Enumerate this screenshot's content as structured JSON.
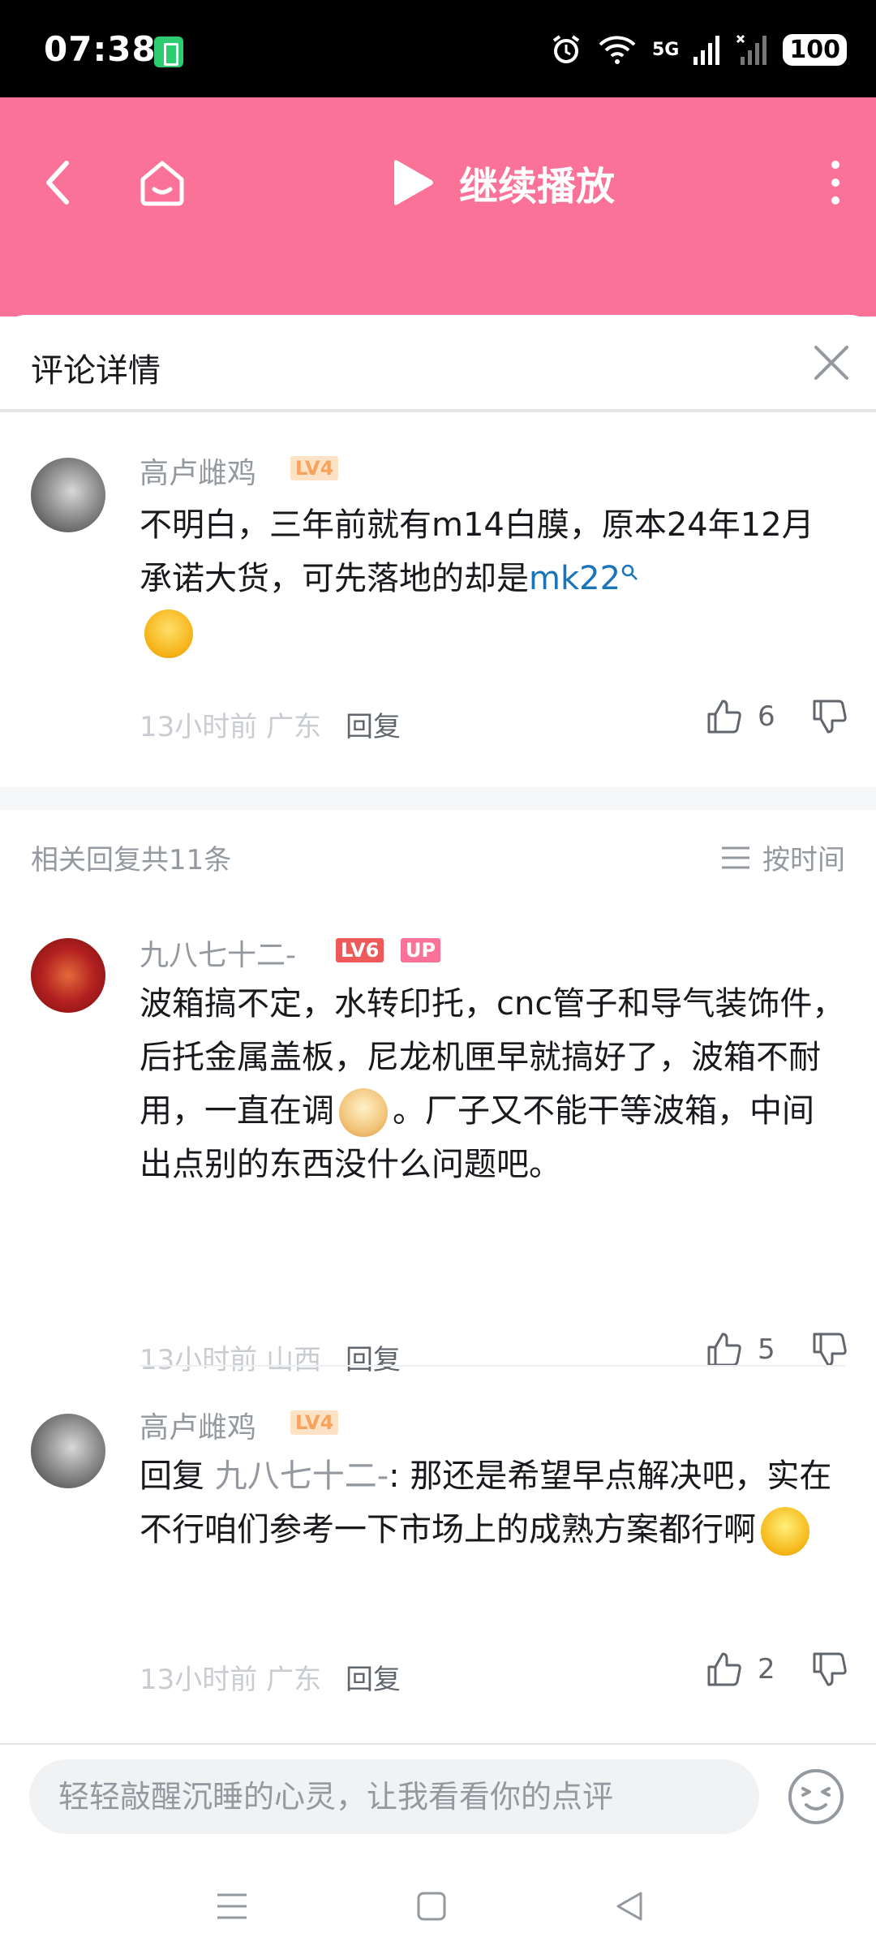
{
  "status_bar": {
    "time": "07:38",
    "network": "5G",
    "battery": "100"
  },
  "top_bar": {
    "play_label": "继续播放",
    "accent_color": "#fb7299",
    "icons": [
      "back-icon",
      "home-icon",
      "play-icon",
      "more-icon"
    ]
  },
  "sheet": {
    "title": "评论详情"
  },
  "main_comment": {
    "username": "高卢雌鸡",
    "level": "LV4",
    "text_a": "不明白，三年前就有m14白膜，原本24年12月承诺大货，可先落地的却是",
    "link": "mk22",
    "time": "13小时前",
    "location": "广东",
    "reply_label": "回复",
    "likes": "6"
  },
  "related": {
    "title": "相关回复共11条",
    "sort_label": "按时间"
  },
  "replies": [
    {
      "username": "九八七十二-",
      "level": "LV6",
      "up_badge": "UP",
      "text_a": "波箱搞不定，水转印托，cnc管子和导气装饰件，后托金属盖板，尼龙机匣早就搞好了，波箱不耐用，一直在调",
      "text_b": "。厂子又不能干等波箱，中间出点别的东西没什么问题吧。",
      "time": "13小时前",
      "location": "山西",
      "reply_label": "回复",
      "likes": "5"
    },
    {
      "username": "高卢雌鸡",
      "level": "LV4",
      "reply_prefix": "回复",
      "reply_to": "九八七十二-",
      "text_a": ": 那还是希望早点解决吧，实在不行咱们参考一下市场上的成熟方案都行啊",
      "time": "13小时前",
      "location": "广东",
      "reply_label": "回复",
      "likes": "2"
    }
  ],
  "input_bar": {
    "placeholder": "轻轻敲醒沉睡的心灵，让我看看你的点评"
  }
}
